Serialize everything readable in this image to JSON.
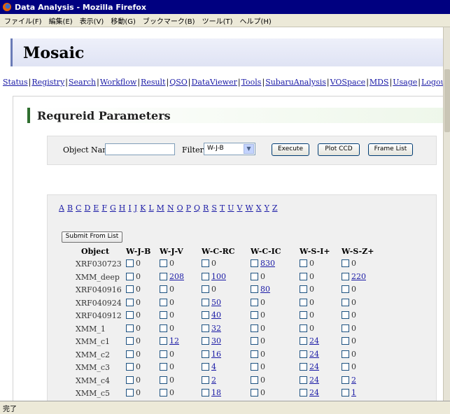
{
  "window": {
    "title": "Data Analysis - Mozilla Firefox"
  },
  "menu": [
    "ファイル(F)",
    "編集(E)",
    "表示(V)",
    "移動(G)",
    "ブックマーク(B)",
    "ツール(T)",
    "ヘルプ(H)"
  ],
  "status": "完了",
  "page": {
    "banner_title": "Mosaic",
    "nav": [
      "Status",
      "Registry",
      "Search",
      "Workflow",
      "Result",
      "QSO",
      "DataViewer",
      "Tools",
      "SubaruAnalysis",
      "VOSpace",
      "MDS",
      "Usage",
      "Logout"
    ],
    "section_title": "Requreid Parameters",
    "form": {
      "object_label": "Object Name:",
      "object_value": "",
      "filter_label": "Filter:",
      "filter_value": "W-J-B",
      "execute_label": "Execute",
      "plot_ccd_label": "Plot CCD",
      "frame_list_label": "Frame List"
    },
    "letters": [
      "A",
      "B",
      "C",
      "D",
      "E",
      "F",
      "G",
      "H",
      "I",
      "J",
      "K",
      "L",
      "M",
      "N",
      "O",
      "P",
      "Q",
      "R",
      "S",
      "T",
      "U",
      "V",
      "W",
      "X",
      "Y",
      "Z"
    ],
    "submit_label": "Submit From List",
    "table": {
      "headers": [
        "Object",
        "W-J-B",
        "W-J-V",
        "W-C-RC",
        "W-C-IC",
        "W-S-I+",
        "W-S-Z+"
      ],
      "rows": [
        {
          "name": "XRF030723",
          "values": [
            "0",
            "0",
            "0",
            "830",
            "0",
            "0"
          ],
          "links": [
            false,
            false,
            false,
            true,
            false,
            false
          ]
        },
        {
          "name": "XMM_deep",
          "values": [
            "0",
            "208",
            "100",
            "0",
            "0",
            "220"
          ],
          "links": [
            false,
            true,
            true,
            false,
            false,
            true
          ]
        },
        {
          "name": "XRF040916",
          "values": [
            "0",
            "0",
            "0",
            "80",
            "0",
            "0"
          ],
          "links": [
            false,
            false,
            false,
            true,
            false,
            false
          ]
        },
        {
          "name": "XRF040924",
          "values": [
            "0",
            "0",
            "50",
            "0",
            "0",
            "0"
          ],
          "links": [
            false,
            false,
            true,
            false,
            false,
            false
          ]
        },
        {
          "name": "XRF040912",
          "values": [
            "0",
            "0",
            "40",
            "0",
            "0",
            "0"
          ],
          "links": [
            false,
            false,
            true,
            false,
            false,
            false
          ]
        },
        {
          "name": "XMM_1",
          "values": [
            "0",
            "0",
            "32",
            "0",
            "0",
            "0"
          ],
          "links": [
            false,
            false,
            true,
            false,
            false,
            false
          ]
        },
        {
          "name": "XMM_c1",
          "values": [
            "0",
            "12",
            "30",
            "0",
            "24",
            "0"
          ],
          "links": [
            false,
            true,
            true,
            false,
            true,
            false
          ]
        },
        {
          "name": "XMM_c2",
          "values": [
            "0",
            "0",
            "16",
            "0",
            "24",
            "0"
          ],
          "links": [
            false,
            false,
            true,
            false,
            true,
            false
          ]
        },
        {
          "name": "XMM_c3",
          "values": [
            "0",
            "0",
            "4",
            "0",
            "24",
            "0"
          ],
          "links": [
            false,
            false,
            true,
            false,
            true,
            false
          ]
        },
        {
          "name": "XMM_c4",
          "values": [
            "0",
            "0",
            "2",
            "0",
            "24",
            "2"
          ],
          "links": [
            false,
            false,
            true,
            false,
            true,
            true
          ]
        },
        {
          "name": "XMM_c5",
          "values": [
            "0",
            "0",
            "18",
            "0",
            "24",
            "1"
          ],
          "links": [
            false,
            false,
            true,
            false,
            true,
            true
          ]
        }
      ]
    }
  }
}
